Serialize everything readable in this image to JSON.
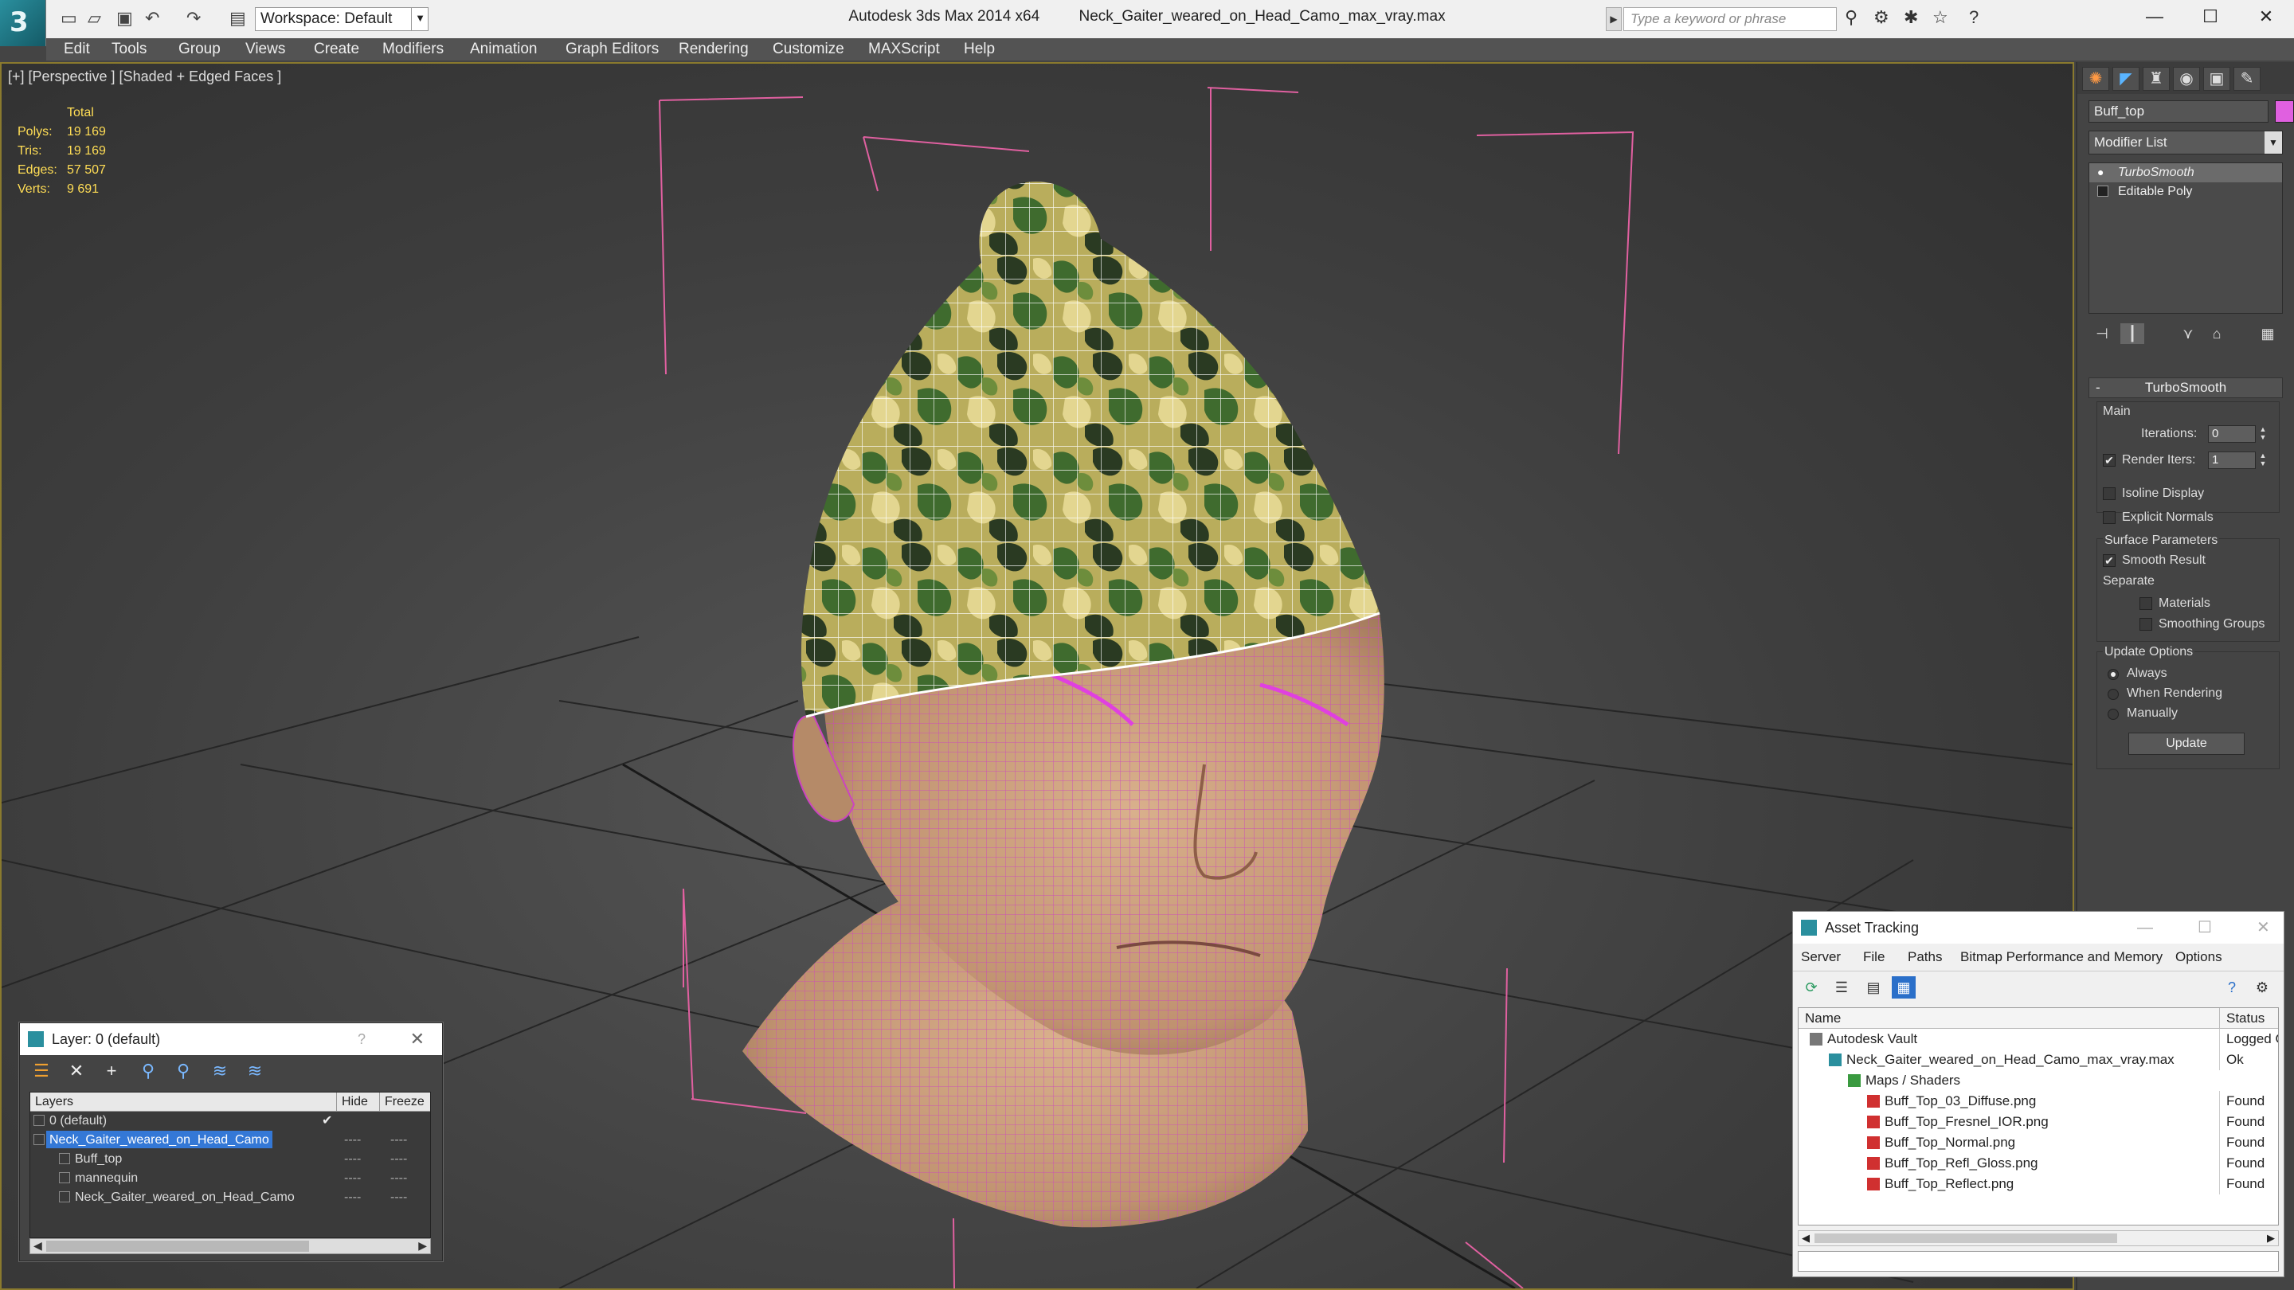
{
  "title_bar": {
    "app_name": "Autodesk 3ds Max  2014 x64",
    "file_name": "Neck_Gaiter_weared_on_Head_Camo_max_vray.max",
    "workspace": "Workspace: Default",
    "search_placeholder": "Type a keyword or phrase",
    "logo_glyph": "3"
  },
  "menu": [
    "Edit",
    "Tools",
    "Group",
    "Views",
    "Create",
    "Modifiers",
    "Animation",
    "Graph Editors",
    "Rendering",
    "Customize",
    "MAXScript",
    "Help"
  ],
  "viewport": {
    "label": "[+] [Perspective ] [Shaded + Edged Faces ]",
    "stats": {
      "header": "Total",
      "rows": [
        {
          "label": "Polys:",
          "value": "19 169"
        },
        {
          "label": "Tris:",
          "value": "19 169"
        },
        {
          "label": "Edges:",
          "value": "57 507"
        },
        {
          "label": "Verts:",
          "value": "9 691"
        }
      ]
    },
    "colors": {
      "selection_box": "#e060a0",
      "head_wire": "#d040c0",
      "skin": "#c8a080",
      "hat_wire": "#ffffff"
    }
  },
  "command_panel": {
    "object_name": "Buff_top",
    "object_color": "#e060e0",
    "modifier_list": "Modifier List",
    "stack": [
      "TurboSmooth",
      "Editable Poly"
    ],
    "rollout": {
      "title": "TurboSmooth",
      "collapse": "-",
      "main": "Main",
      "iterations_label": "Iterations:",
      "iterations_value": "0",
      "render_iters_label": "Render Iters:",
      "render_iters_value": "1",
      "render_iters_checked": "✔",
      "isoline": "Isoline Display",
      "explicit_normals": "Explicit Normals",
      "surface_params": "Surface Parameters",
      "smooth_result": "Smooth Result",
      "smooth_result_checked": "✔",
      "separate": "Separate",
      "materials": "Materials",
      "smoothing_groups": "Smoothing Groups",
      "update_options": "Update Options",
      "always": "Always",
      "when_rendering": "When Rendering",
      "manually": "Manually",
      "update_button": "Update"
    }
  },
  "layer_dialog": {
    "title": "Layer: 0 (default)",
    "help": "?",
    "columns": {
      "layers": "Layers",
      "hide": "Hide",
      "freeze": "Freeze"
    },
    "rows": [
      {
        "name": "0 (default)",
        "indent": 0,
        "check": "✔",
        "hide": "",
        "freeze": ""
      },
      {
        "name": "Neck_Gaiter_weared_on_Head_Camo",
        "indent": 0,
        "check": "",
        "hide": "----",
        "freeze": "----",
        "selected": true
      },
      {
        "name": "Buff_top",
        "indent": 1,
        "check": "",
        "hide": "----",
        "freeze": "----"
      },
      {
        "name": "mannequin",
        "indent": 1,
        "check": "",
        "hide": "----",
        "freeze": "----"
      },
      {
        "name": "Neck_Gaiter_weared_on_Head_Camo",
        "indent": 1,
        "check": "",
        "hide": "----",
        "freeze": "----"
      }
    ]
  },
  "asset_tracking": {
    "title": "Asset Tracking",
    "menu": [
      "Server",
      "File",
      "Paths",
      "Bitmap Performance and Memory",
      "Options"
    ],
    "columns": {
      "name": "Name",
      "status": "Status"
    },
    "rows": [
      {
        "name": "Autodesk Vault",
        "status": "Logged O",
        "indent": 0,
        "icon": "vault-icon"
      },
      {
        "name": "Neck_Gaiter_weared_on_Head_Camo_max_vray.max",
        "status": "Ok",
        "indent": 1,
        "icon": "max-file-icon"
      },
      {
        "name": "Maps / Shaders",
        "status": "",
        "indent": 2,
        "icon": "maps-icon"
      },
      {
        "name": "Buff_Top_03_Diffuse.png",
        "status": "Found",
        "indent": 3,
        "icon": "png-icon"
      },
      {
        "name": "Buff_Top_Fresnel_IOR.png",
        "status": "Found",
        "indent": 3,
        "icon": "png-icon"
      },
      {
        "name": "Buff_Top_Normal.png",
        "status": "Found",
        "indent": 3,
        "icon": "png-icon"
      },
      {
        "name": "Buff_Top_Refl_Gloss.png",
        "status": "Found",
        "indent": 3,
        "icon": "png-icon"
      },
      {
        "name": "Buff_Top_Reflect.png",
        "status": "Found",
        "indent": 3,
        "icon": "png-icon"
      }
    ]
  }
}
